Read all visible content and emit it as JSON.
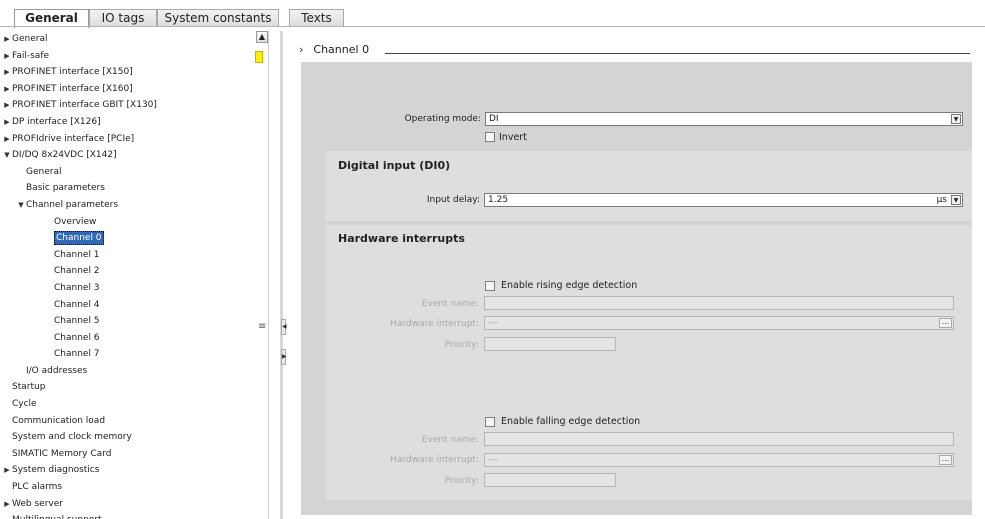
{
  "tabs": [
    {
      "label": "General",
      "active": true
    },
    {
      "label": "IO tags",
      "active": false
    },
    {
      "label": "System constants",
      "active": false
    },
    {
      "label": "Texts",
      "active": false
    }
  ],
  "tree": [
    {
      "label": "General",
      "level": 0,
      "arrow": "collapsed"
    },
    {
      "label": "Fail-safe",
      "level": 0,
      "arrow": "collapsed"
    },
    {
      "label": "PROFINET interface [X150]",
      "level": 0,
      "arrow": "collapsed"
    },
    {
      "label": "PROFINET interface [X160]",
      "level": 0,
      "arrow": "collapsed"
    },
    {
      "label": "PROFINET interface GBIT [X130]",
      "level": 0,
      "arrow": "collapsed"
    },
    {
      "label": "DP interface [X126]",
      "level": 0,
      "arrow": "collapsed"
    },
    {
      "label": "PROFIdrive interface [PCIe]",
      "level": 0,
      "arrow": "collapsed"
    },
    {
      "label": "DI/DQ 8x24VDC [X142]",
      "level": 0,
      "arrow": "expanded"
    },
    {
      "label": "General",
      "level": 1,
      "arrow": "none"
    },
    {
      "label": "Basic parameters",
      "level": 1,
      "arrow": "none"
    },
    {
      "label": "Channel parameters",
      "level": 1,
      "arrow": "expanded"
    },
    {
      "label": "Overview",
      "level": 2,
      "arrow": "none"
    },
    {
      "label": "Channel 0",
      "level": 2,
      "arrow": "none",
      "selected": true
    },
    {
      "label": "Channel 1",
      "level": 2,
      "arrow": "none"
    },
    {
      "label": "Channel 2",
      "level": 2,
      "arrow": "none"
    },
    {
      "label": "Channel 3",
      "level": 2,
      "arrow": "none"
    },
    {
      "label": "Channel 4",
      "level": 2,
      "arrow": "none"
    },
    {
      "label": "Channel 5",
      "level": 2,
      "arrow": "none"
    },
    {
      "label": "Channel 6",
      "level": 2,
      "arrow": "none"
    },
    {
      "label": "Channel 7",
      "level": 2,
      "arrow": "none"
    },
    {
      "label": "I/O addresses",
      "level": 1,
      "arrow": "none"
    },
    {
      "label": "Startup",
      "level": 0,
      "arrow": "none"
    },
    {
      "label": "Cycle",
      "level": 0,
      "arrow": "none"
    },
    {
      "label": "Communication load",
      "level": 0,
      "arrow": "none"
    },
    {
      "label": "System and clock memory",
      "level": 0,
      "arrow": "none"
    },
    {
      "label": "SIMATIC Memory Card",
      "level": 0,
      "arrow": "none"
    },
    {
      "label": "System diagnostics",
      "level": 0,
      "arrow": "collapsed"
    },
    {
      "label": "PLC alarms",
      "level": 0,
      "arrow": "none"
    },
    {
      "label": "Web server",
      "level": 0,
      "arrow": "collapsed"
    },
    {
      "label": "Multilingual support",
      "level": 0,
      "arrow": "none"
    }
  ],
  "content": {
    "section_title": "Channel 0",
    "operating_mode": {
      "label": "Operating mode:",
      "value": "DI"
    },
    "invert": {
      "label": "Invert",
      "checked": false
    },
    "digital_input": {
      "title": "Digital input (DI0)",
      "input_delay": {
        "label": "Input delay:",
        "value": "1.25",
        "unit": "µs"
      }
    },
    "hardware_interrupts": {
      "title": "Hardware interrupts",
      "rising": {
        "checkbox_label": "Enable rising edge detection",
        "checked": false,
        "event_name_label": "Event name:",
        "event_name_value": "",
        "hw_interrupt_label": "Hardware interrupt:",
        "hw_interrupt_value": "---",
        "priority_label": "Priority:",
        "priority_value": ""
      },
      "falling": {
        "checkbox_label": "Enable falling edge detection",
        "checked": false,
        "event_name_label": "Event name:",
        "event_name_value": "",
        "hw_interrupt_label": "Hardware interrupt:",
        "hw_interrupt_value": "---",
        "priority_label": "Priority:",
        "priority_value": ""
      }
    },
    "ellipsis_label": "...",
    "colors": {
      "selection": "#3269b7",
      "panel_gray": "#d4d4d4",
      "marker_yellow": "#ffef00"
    }
  }
}
